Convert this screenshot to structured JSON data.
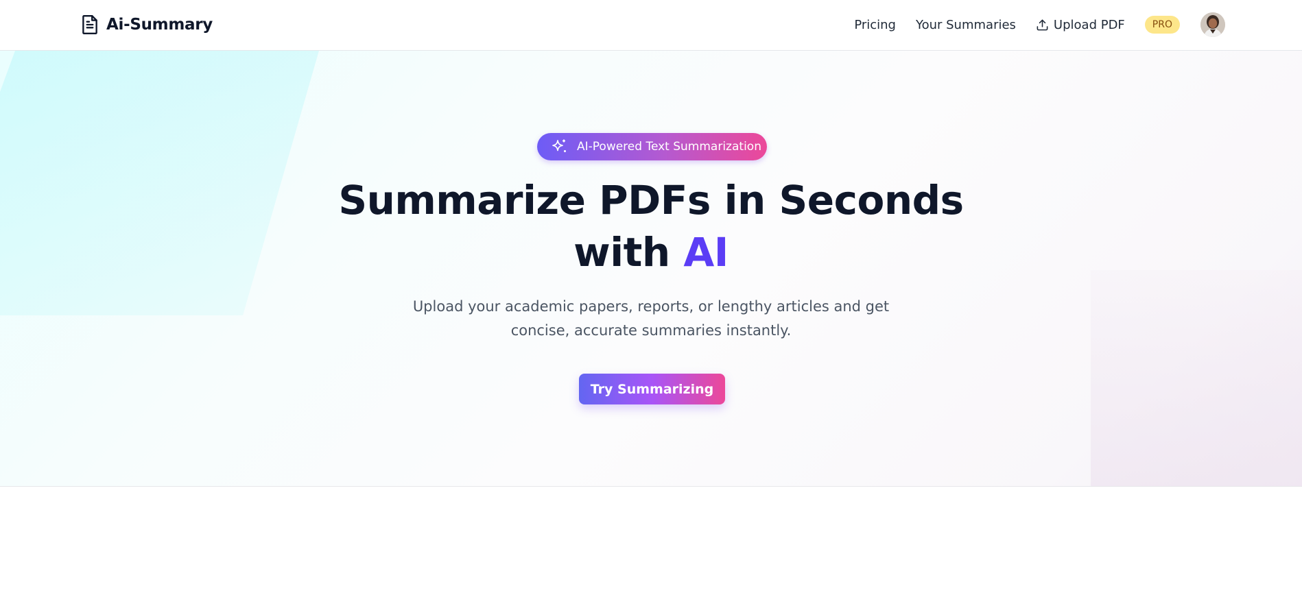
{
  "app": {
    "name": "Ai-Summary",
    "logo_icon": "document-icon"
  },
  "nav": {
    "links": [
      {
        "label": "Pricing"
      },
      {
        "label": "Your Summaries"
      },
      {
        "label": "Upload PDF",
        "icon": "upload-icon"
      }
    ],
    "badge": "PRO",
    "avatar_icon": "user-avatar"
  },
  "hero": {
    "pill_label": "AI-Powered Text Summarization",
    "pill_icon": "sparkles-icon",
    "headline_line1": "Summarize PDFs in Seconds",
    "headline_line2_prefix": "with",
    "headline_accent": "AI",
    "subtitle_line1": "Upload your academic papers, reports, or lengthy articles and get",
    "subtitle_line2": "concise, accurate summaries instantly.",
    "cta_label": "Try Summarizing"
  },
  "colors": {
    "accent": "#5b3df5",
    "gradient_start": "#6366f1",
    "gradient_end": "#ec4899",
    "pro_badge_bg": "#fde68a",
    "text_dark": "#0f172a"
  }
}
